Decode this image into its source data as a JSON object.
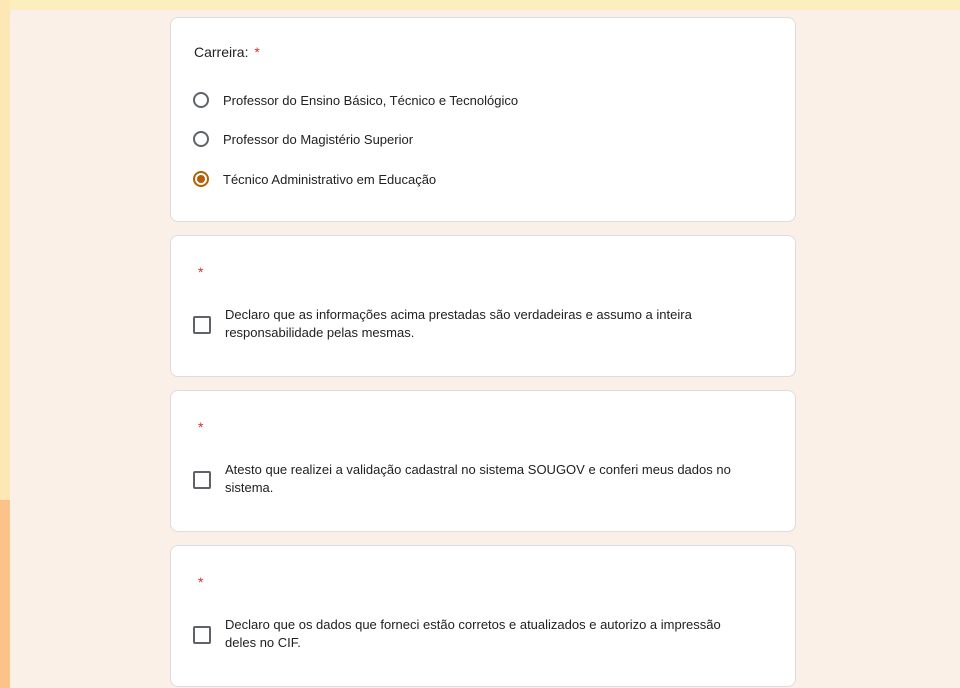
{
  "question_career": {
    "title": "Carreira:",
    "required_mark": "*",
    "options": [
      {
        "label": "Professor do Ensino Básico, Técnico e Tecnológico",
        "checked": false
      },
      {
        "label": "Professor do Magistério Superior",
        "checked": false
      },
      {
        "label": "Técnico Administrativo em Educação",
        "checked": true
      }
    ]
  },
  "declarations": [
    {
      "required_mark": "*",
      "label": "Declaro que as informações acima prestadas são verdadeiras e assumo a inteira responsabilidade pelas mesmas.",
      "checked": false
    },
    {
      "required_mark": "*",
      "label": "Atesto que realizei a validação cadastral no sistema SOUGOV e conferi meus dados no sistema.",
      "checked": false
    },
    {
      "required_mark": "*",
      "label": "Declaro que os dados que forneci estão corretos e atualizados e autorizo a impressão deles no CIF.",
      "checked": false
    }
  ],
  "colors": {
    "accent": "#b45f06",
    "required": "#d93025",
    "background": "#fbf0e8"
  }
}
